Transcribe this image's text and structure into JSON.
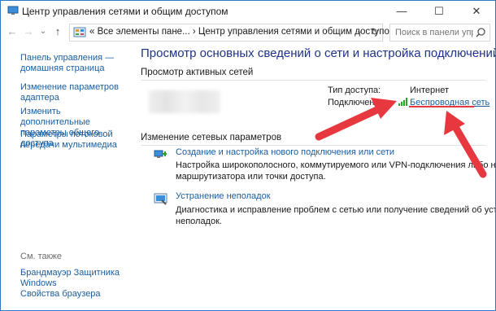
{
  "window": {
    "title": "Центр управления сетями и общим доступом",
    "minimize": "—",
    "maximize": "☐",
    "close": "✕"
  },
  "nav": {
    "back": "←",
    "forward": "→",
    "recent": "⌄",
    "up": "↑",
    "icons": [
      "arrow-left-icon",
      "arrow-right-icon",
      "chevron-down-icon",
      "arrow-up-icon",
      "control-panel-icon",
      "refresh-icon",
      "search-icon"
    ]
  },
  "address": {
    "crumbs": "«  Все элементы пане...  ›  Центр управления сетями и общим доступом  ›",
    "dropdown": "⌄",
    "refresh": "↻"
  },
  "search": {
    "placeholder": "Поиск в панели упра..."
  },
  "sidebar": {
    "links": [
      "Панель управления — домашняя страница",
      "Изменение параметров адаптера",
      "Изменить дополнительные параметры общего доступа",
      "Параметры потоковой передачи мультимедиа"
    ],
    "see_also": "См. также",
    "see_also_links": [
      "Брандмауэр Защитника Windows",
      "Свойства браузера"
    ]
  },
  "main": {
    "title": "Просмотр основных сведений о сети и настройка подключений",
    "active_networks_heading": "Просмотр активных сетей",
    "access_type_label": "Тип доступа:",
    "access_type_value": "Интернет",
    "connections_label": "Подключения:",
    "connection_name": "Беспроводная сеть",
    "change_heading": "Изменение сетевых параметров",
    "tasks": [
      {
        "link": "Создание и настройка нового подключения или сети",
        "desc1": "Настройка широкополосного, коммутируемого или VPN-подключения либо настро",
        "desc2": "маршрутизатора или точки доступа."
      },
      {
        "link": "Устранение неполадок",
        "desc1": "Диагностика и исправление проблем с сетью или получение сведений об устранении",
        "desc2": "неполадок."
      }
    ]
  },
  "colors": {
    "link": "#1a5d9e",
    "title": "#1e3287",
    "arrow": "#e8383f",
    "wifi": "#2aa02a",
    "border": "#2b79c2"
  }
}
